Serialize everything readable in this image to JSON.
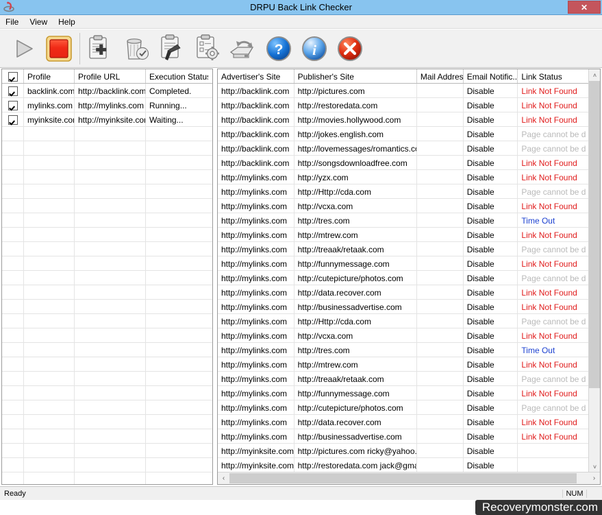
{
  "window": {
    "title": "DRPU Back Link Checker",
    "icon": "app-logo-icon",
    "close_label": "✕"
  },
  "menu": {
    "items": [
      {
        "label": "File"
      },
      {
        "label": "View"
      },
      {
        "label": "Help"
      }
    ]
  },
  "toolbar": {
    "buttons": [
      {
        "name": "start-button",
        "icon": "play-triangle-icon",
        "enabled": false
      },
      {
        "name": "stop-button",
        "icon": "stop-square-icon",
        "enabled": true
      },
      {
        "name": "add-project-button",
        "icon": "clipboard-plus-icon",
        "enabled": true
      },
      {
        "name": "delete-project-button",
        "icon": "trash-can-icon",
        "enabled": true
      },
      {
        "name": "edit-project-button",
        "icon": "clipboard-pen-icon",
        "enabled": true
      },
      {
        "name": "project-settings-button",
        "icon": "clipboard-gear-icon",
        "enabled": true
      },
      {
        "name": "refresh-button",
        "icon": "disk-refresh-icon",
        "enabled": true
      },
      {
        "name": "help-button",
        "icon": "blue-question-icon",
        "enabled": true
      },
      {
        "name": "about-button",
        "icon": "blue-info-icon",
        "enabled": true
      },
      {
        "name": "exit-button",
        "icon": "red-x-icon",
        "enabled": true
      }
    ]
  },
  "left_grid": {
    "headers": [
      "",
      "Profile",
      "Profile URL",
      "Execution Status"
    ],
    "header_checkbox_checked": true,
    "rows": [
      {
        "checked": true,
        "profile": "backlink.com",
        "profile_url": "http://backlink.com",
        "status": "Completed."
      },
      {
        "checked": true,
        "profile": "mylinks.com",
        "profile_url": "http://mylinks.com",
        "status": "Running..."
      },
      {
        "checked": true,
        "profile": "myinksite.com",
        "profile_url": "http://myinksite.com",
        "status": "Waiting..."
      }
    ],
    "empty_row_count": 25
  },
  "right_grid": {
    "headers": [
      "Advertiser's Site",
      "Publisher's Site",
      "Mail Address",
      "Email Notific...",
      "Link Status"
    ],
    "rows": [
      {
        "advertiser": "http://backlink.com",
        "publisher": "http://pictures.com",
        "mail": "",
        "notify": "Disable",
        "status": "Link Not Found",
        "status_color": "red"
      },
      {
        "advertiser": "http://backlink.com",
        "publisher": "http://restoredata.com",
        "mail": "",
        "notify": "Disable",
        "status": "Link Not Found",
        "status_color": "red"
      },
      {
        "advertiser": "http://backlink.com",
        "publisher": "http://movies.hollywood.com",
        "mail": "",
        "notify": "Disable",
        "status": "Link Not Found",
        "status_color": "red"
      },
      {
        "advertiser": "http://backlink.com",
        "publisher": "http://jokes.english.com",
        "mail": "",
        "notify": "Disable",
        "status": "Page cannot be d",
        "status_color": "gray"
      },
      {
        "advertiser": "http://backlink.com",
        "publisher": "http://lovemessages/romantics.com",
        "mail": "",
        "notify": "Disable",
        "status": "Page cannot be d",
        "status_color": "gray"
      },
      {
        "advertiser": "http://backlink.com",
        "publisher": "http://songsdownloadfree.com",
        "mail": "",
        "notify": "Disable",
        "status": "Link Not Found",
        "status_color": "red"
      },
      {
        "advertiser": "http://mylinks.com",
        "publisher": "http://yzx.com",
        "mail": "",
        "notify": "Disable",
        "status": "Link Not Found",
        "status_color": "red"
      },
      {
        "advertiser": "http://mylinks.com",
        "publisher": "http://Http://cda.com",
        "mail": "",
        "notify": "Disable",
        "status": "Page cannot be d",
        "status_color": "gray"
      },
      {
        "advertiser": "http://mylinks.com",
        "publisher": "http://vcxa.com",
        "mail": "",
        "notify": "Disable",
        "status": "Link Not Found",
        "status_color": "red"
      },
      {
        "advertiser": "http://mylinks.com",
        "publisher": "http://tres.com",
        "mail": "",
        "notify": "Disable",
        "status": "Time Out",
        "status_color": "blue"
      },
      {
        "advertiser": "http://mylinks.com",
        "publisher": "http://mtrew.com",
        "mail": "",
        "notify": "Disable",
        "status": "Link Not Found",
        "status_color": "red"
      },
      {
        "advertiser": "http://mylinks.com",
        "publisher": "http://treaak/retaak.com",
        "mail": "",
        "notify": "Disable",
        "status": "Page cannot be d",
        "status_color": "gray"
      },
      {
        "advertiser": "http://mylinks.com",
        "publisher": "http://funnymessage.com",
        "mail": "",
        "notify": "Disable",
        "status": "Link Not Found",
        "status_color": "red"
      },
      {
        "advertiser": "http://mylinks.com",
        "publisher": "http://cutepicture/photos.com",
        "mail": "",
        "notify": "Disable",
        "status": "Page cannot be d",
        "status_color": "gray"
      },
      {
        "advertiser": "http://mylinks.com",
        "publisher": "http://data.recover.com",
        "mail": "",
        "notify": "Disable",
        "status": "Link Not Found",
        "status_color": "red"
      },
      {
        "advertiser": "http://mylinks.com",
        "publisher": "http://businessadvertise.com",
        "mail": "",
        "notify": "Disable",
        "status": "Link Not Found",
        "status_color": "red"
      },
      {
        "advertiser": "http://mylinks.com",
        "publisher": "http://Http://cda.com",
        "mail": "",
        "notify": "Disable",
        "status": "Page cannot be d",
        "status_color": "gray"
      },
      {
        "advertiser": "http://mylinks.com",
        "publisher": "http://vcxa.com",
        "mail": "",
        "notify": "Disable",
        "status": "Link Not Found",
        "status_color": "red"
      },
      {
        "advertiser": "http://mylinks.com",
        "publisher": "http://tres.com",
        "mail": "",
        "notify": "Disable",
        "status": "Time Out",
        "status_color": "blue"
      },
      {
        "advertiser": "http://mylinks.com",
        "publisher": "http://mtrew.com",
        "mail": "",
        "notify": "Disable",
        "status": "Link Not Found",
        "status_color": "red"
      },
      {
        "advertiser": "http://mylinks.com",
        "publisher": "http://treaak/retaak.com",
        "mail": "",
        "notify": "Disable",
        "status": "Page cannot be d",
        "status_color": "gray"
      },
      {
        "advertiser": "http://mylinks.com",
        "publisher": "http://funnymessage.com",
        "mail": "",
        "notify": "Disable",
        "status": "Link Not Found",
        "status_color": "red"
      },
      {
        "advertiser": "http://mylinks.com",
        "publisher": "http://cutepicture/photos.com",
        "mail": "",
        "notify": "Disable",
        "status": "Page cannot be d",
        "status_color": "gray"
      },
      {
        "advertiser": "http://mylinks.com",
        "publisher": "http://data.recover.com",
        "mail": "",
        "notify": "Disable",
        "status": "Link Not Found",
        "status_color": "red"
      },
      {
        "advertiser": "http://mylinks.com",
        "publisher": "http://businessadvertise.com",
        "mail": "",
        "notify": "Disable",
        "status": "Link Not Found",
        "status_color": "red"
      },
      {
        "advertiser": "http://myinksite.com",
        "publisher": "http://pictures.com ricky@yahoo.co",
        "mail": "",
        "notify": "Disable",
        "status": "",
        "status_color": "red"
      },
      {
        "advertiser": "http://myinksite.com",
        "publisher": "http://restoredata.com jack@gmail.c",
        "mail": "",
        "notify": "Disable",
        "status": "",
        "status_color": "red"
      }
    ]
  },
  "scrollbars": {
    "vertical_up": "˄",
    "vertical_down": "˅",
    "horizontal_left": "‹",
    "horizontal_right": "›"
  },
  "statusbar": {
    "message": "Ready",
    "num_indicator": "NUM"
  },
  "watermark": {
    "text": "Recoverymonster.com"
  }
}
